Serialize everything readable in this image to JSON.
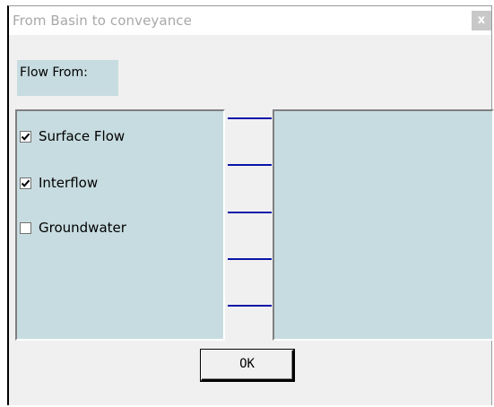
{
  "window": {
    "title": "From Basin to conveyance",
    "close_label": "x"
  },
  "flow_from": {
    "label": "Flow From:"
  },
  "options": [
    {
      "label": "Surface Flow",
      "checked": true
    },
    {
      "label": "Interflow",
      "checked": true
    },
    {
      "label": "Groundwater",
      "checked": false
    }
  ],
  "buttons": {
    "ok_label": "OK"
  },
  "colors": {
    "panel_bg": "#c7dce0",
    "connector_line": "#0a14a8",
    "dialog_bg": "#f0f0f0"
  }
}
